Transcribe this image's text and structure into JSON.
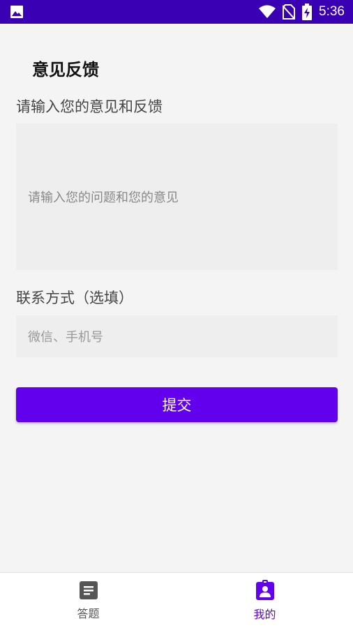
{
  "status_bar": {
    "time": "5:36",
    "icons": [
      "image-icon",
      "wifi-icon",
      "no-sim-icon",
      "battery-charging-icon"
    ]
  },
  "page": {
    "title": "意见反馈"
  },
  "feedback": {
    "label": "请输入您的意见和反馈",
    "placeholder": "请输入您的问题和您的意见"
  },
  "contact": {
    "label": "联系方式（选填）",
    "placeholder": "微信、手机号"
  },
  "submit": {
    "label": "提交"
  },
  "bottom_nav": {
    "items": [
      {
        "label": "答题",
        "icon": "document-icon",
        "active": false
      },
      {
        "label": "我的",
        "icon": "profile-badge-icon",
        "active": true
      }
    ]
  },
  "colors": {
    "status_bar": "#3a00b3",
    "accent": "#6200ee",
    "background": "#f4f4f4",
    "input_background": "#eeeeee"
  }
}
